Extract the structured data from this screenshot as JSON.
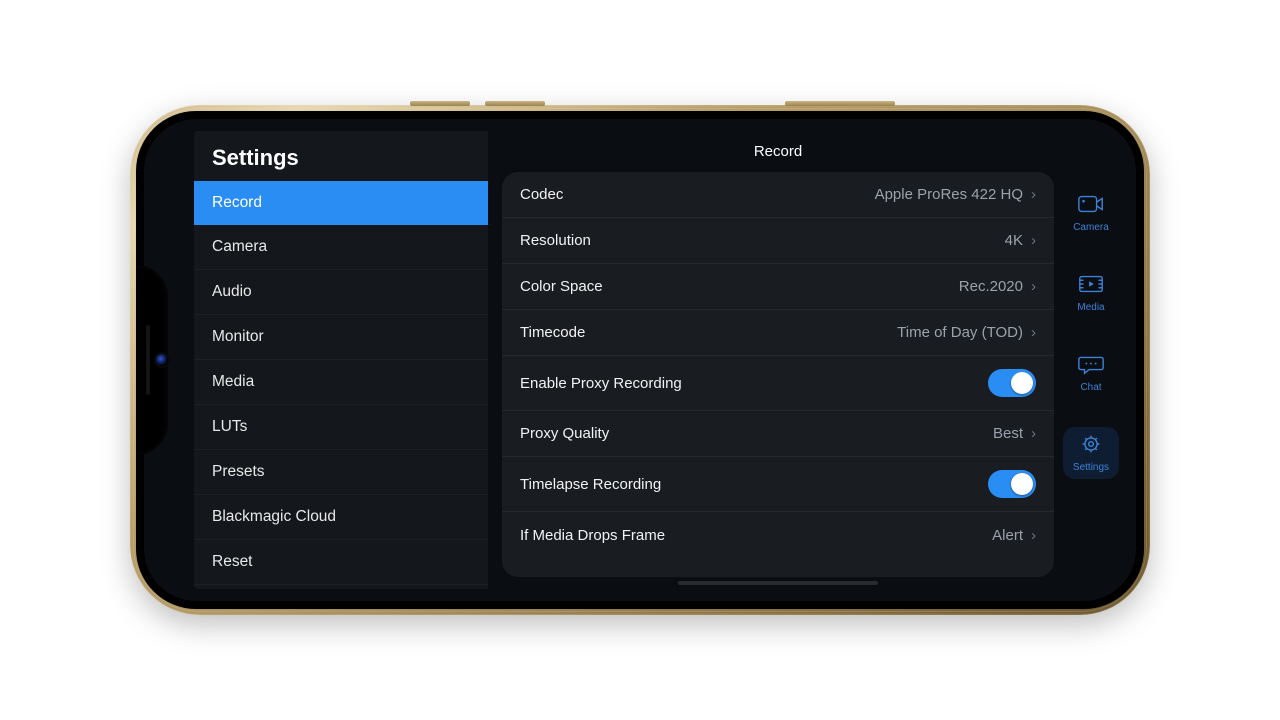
{
  "sidebar": {
    "title": "Settings",
    "items": [
      {
        "label": "Record",
        "active": true
      },
      {
        "label": "Camera"
      },
      {
        "label": "Audio"
      },
      {
        "label": "Monitor"
      },
      {
        "label": "Media"
      },
      {
        "label": "LUTs"
      },
      {
        "label": "Presets"
      },
      {
        "label": "Blackmagic Cloud"
      },
      {
        "label": "Reset"
      }
    ]
  },
  "main": {
    "title": "Record",
    "rows": [
      {
        "label": "Codec",
        "kind": "drill",
        "value": "Apple ProRes 422 HQ"
      },
      {
        "label": "Resolution",
        "kind": "drill",
        "value": "4K"
      },
      {
        "label": "Color Space",
        "kind": "drill",
        "value": "Rec.2020"
      },
      {
        "label": "Timecode",
        "kind": "drill",
        "value": "Time of Day (TOD)"
      },
      {
        "label": "Enable Proxy Recording",
        "kind": "toggle",
        "value": true
      },
      {
        "label": "Proxy Quality",
        "kind": "drill",
        "value": "Best"
      },
      {
        "label": "Timelapse Recording",
        "kind": "toggle",
        "value": true
      },
      {
        "label": "If Media Drops Frame",
        "kind": "drill",
        "value": "Alert"
      }
    ]
  },
  "rail": {
    "items": [
      {
        "label": "Camera",
        "icon": "camera"
      },
      {
        "label": "Media",
        "icon": "media"
      },
      {
        "label": "Chat",
        "icon": "chat"
      },
      {
        "label": "Settings",
        "icon": "settings",
        "active": true
      }
    ]
  }
}
